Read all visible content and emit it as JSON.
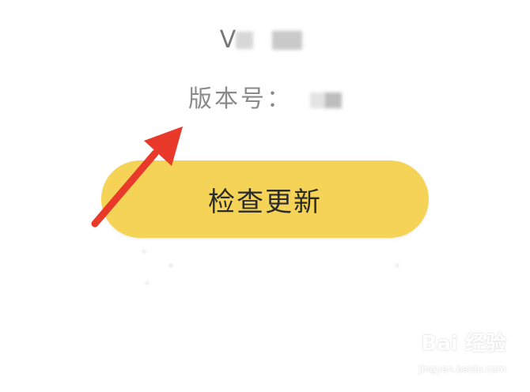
{
  "app": {
    "top_cut_text": "· · · ·"
  },
  "version": {
    "prefix": "V"
  },
  "build": {
    "label": "版本号："
  },
  "actions": {
    "check_update_label": "检查更新"
  },
  "watermark": {
    "logo_text": "Bai 经验",
    "url": "jingyan.baidu.com"
  },
  "colors": {
    "button_fill": "#f4d356",
    "arrow": "#e8392a",
    "text_dark": "#2b2b2b",
    "text_gray": "#8a8a8a"
  },
  "icons": {
    "annotation": "arrow-icon",
    "watermark_logo": "paw-icon"
  }
}
